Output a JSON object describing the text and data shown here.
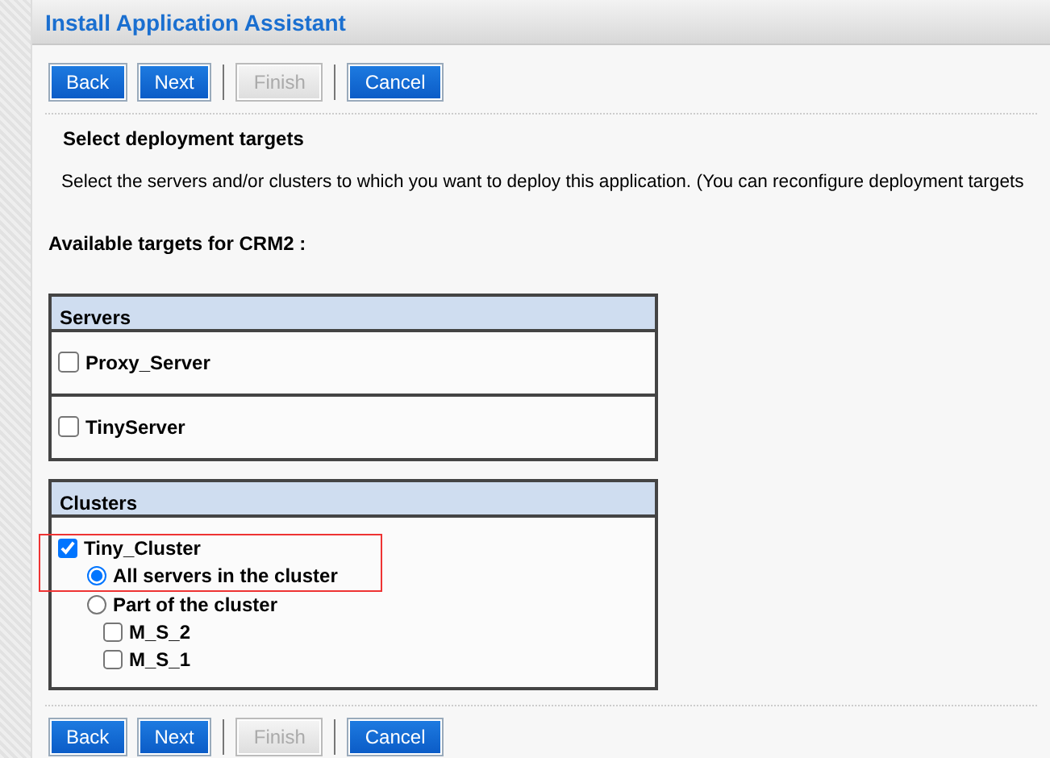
{
  "title": "Install Application Assistant",
  "top_buttons": [
    {
      "label": "Back",
      "disabled": false
    },
    {
      "label": "Next",
      "disabled": false
    },
    {
      "label": "Finish",
      "disabled": true
    },
    {
      "label": "Cancel",
      "disabled": false
    }
  ],
  "heading": "Select deployment targets",
  "description": "Select the servers and/or clusters to which you want to deploy this application. (You can reconfigure deployment targets",
  "available_label": "Available targets for CRM2 :",
  "servers": {
    "heading": "Servers",
    "items": [
      {
        "label": "Proxy_Server",
        "checked": false
      },
      {
        "label": "TinyServer",
        "checked": false
      }
    ]
  },
  "clusters": {
    "heading": "Clusters",
    "items": [
      {
        "label": "Tiny_Cluster",
        "checked": true,
        "highlighted": true,
        "options": [
          {
            "label": "All servers in the cluster",
            "selected": true,
            "highlighted": true
          },
          {
            "label": "Part of the cluster",
            "selected": false,
            "children": [
              {
                "label": "M_S_2",
                "checked": false
              },
              {
                "label": "M_S_1",
                "checked": false
              }
            ]
          }
        ]
      }
    ]
  },
  "bottom_buttons": [
    {
      "label": "Back",
      "disabled": false
    },
    {
      "label": "Next",
      "disabled": false
    },
    {
      "label": "Finish",
      "disabled": true
    },
    {
      "label": "Cancel",
      "disabled": false
    }
  ]
}
